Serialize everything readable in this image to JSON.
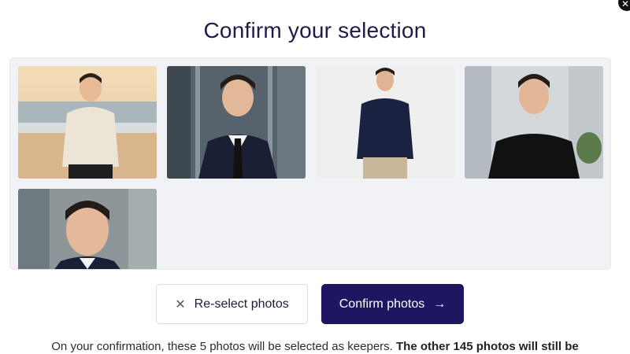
{
  "dialog": {
    "title": "Confirm your selection",
    "close_icon": "close-icon"
  },
  "gallery": {
    "photos": [
      {
        "name": "photo-beach",
        "background": "#e9d1ad",
        "outfit": "#e8dfcd"
      },
      {
        "name": "photo-suit-office",
        "background": "#57636d",
        "outfit": "#1a1f33"
      },
      {
        "name": "photo-navy-sweater",
        "background": "#efefef",
        "outfit": "#1b2140"
      },
      {
        "name": "photo-black-tshirt",
        "background": "#d6d9dc",
        "outfit": "#111111"
      },
      {
        "name": "photo-suit-closeup",
        "background": "#8d9498",
        "outfit": "#172036"
      }
    ]
  },
  "actions": {
    "reselect_label": "Re-select photos",
    "reselect_icon": "x-icon",
    "confirm_label": "Confirm photos",
    "confirm_icon": "arrow-right-icon"
  },
  "footer": {
    "text_regular": "On your confirmation, these 5 photos will be selected as keepers.",
    "text_bold": "The other 145 photos will still be"
  },
  "colors": {
    "primary": "#1e1660",
    "title": "#1f1b4d",
    "gallery_bg": "#f1f2f5"
  }
}
